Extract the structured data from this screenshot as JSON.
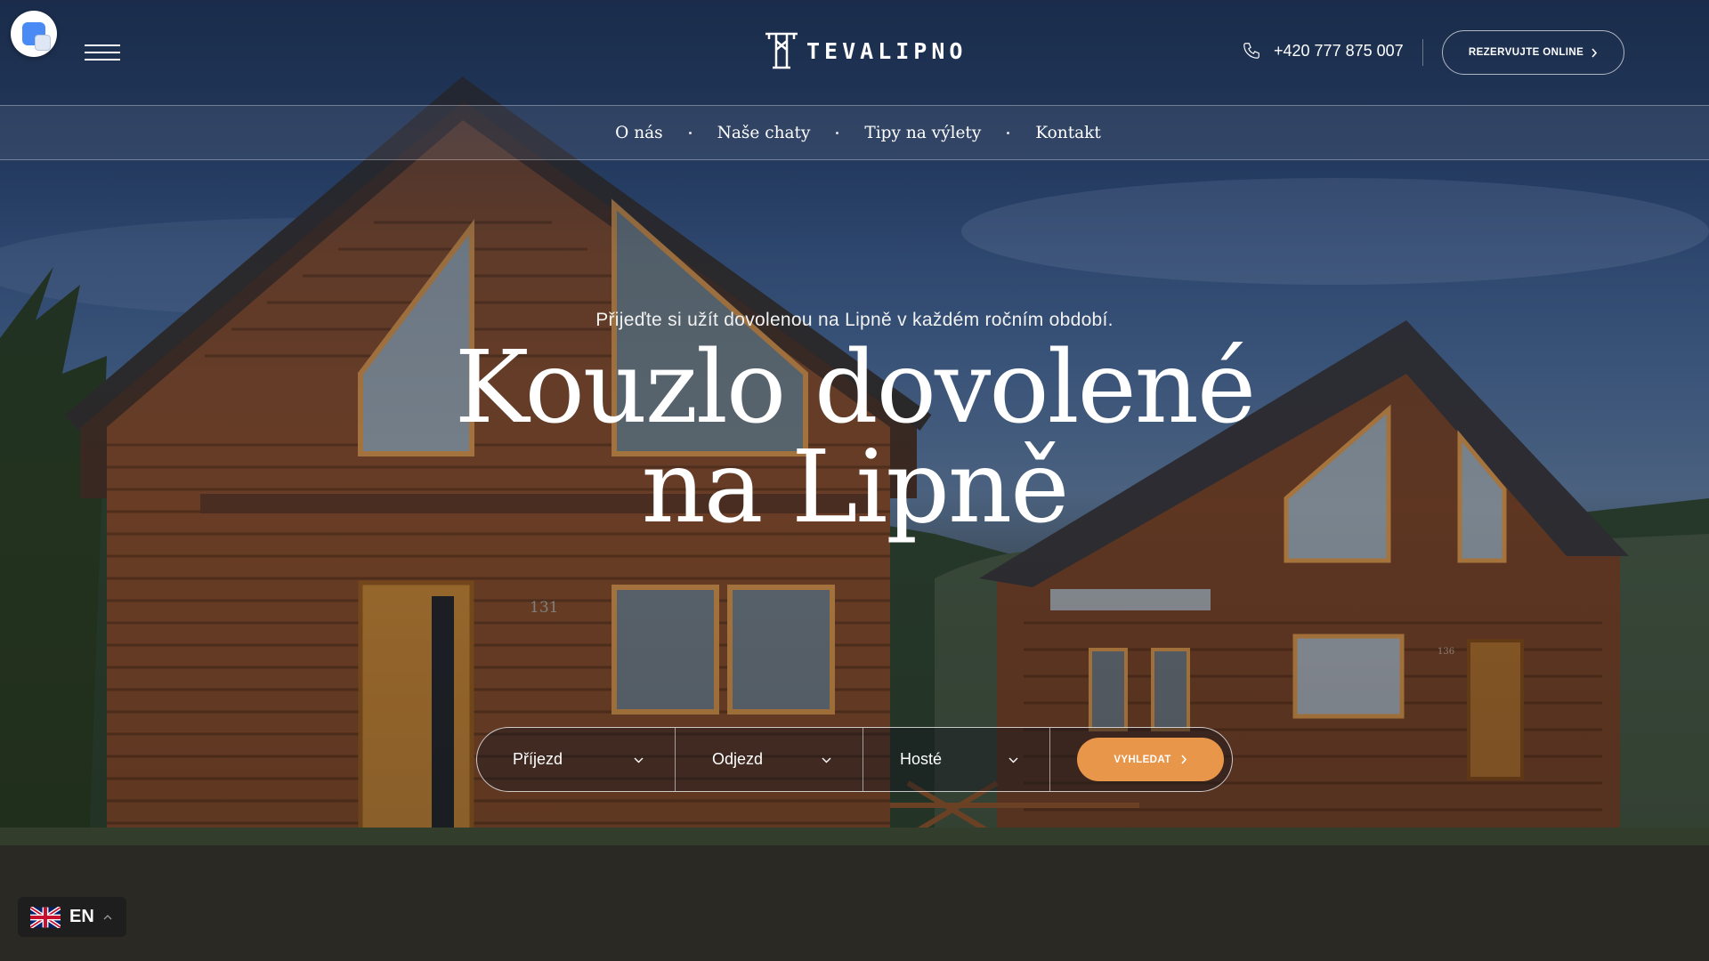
{
  "header": {
    "logo_text": "TEVALIPNO",
    "phone": "+420 777 875 007",
    "reserve_label": "REZERVUJTE ONLINE"
  },
  "nav": {
    "items": [
      {
        "label": "O nás"
      },
      {
        "label": "Naše chaty"
      },
      {
        "label": "Tipy na výlety"
      },
      {
        "label": "Kontakt"
      }
    ]
  },
  "hero": {
    "subtitle": "Přijeďte si užít dovolenou na Lipně v každém ročním období.",
    "headline_line1": "Kouzlo dovolené",
    "headline_line2": "na Lipně",
    "cabin_numbers": [
      "131",
      "136"
    ]
  },
  "booking": {
    "arrival_label": "Příjezd",
    "departure_label": "Odjezd",
    "guests_label": "Hosté",
    "search_label": "VYHLEDAT"
  },
  "language": {
    "code": "EN"
  },
  "colors": {
    "accent": "#e8964a",
    "footer_bg": "#2a2924"
  }
}
